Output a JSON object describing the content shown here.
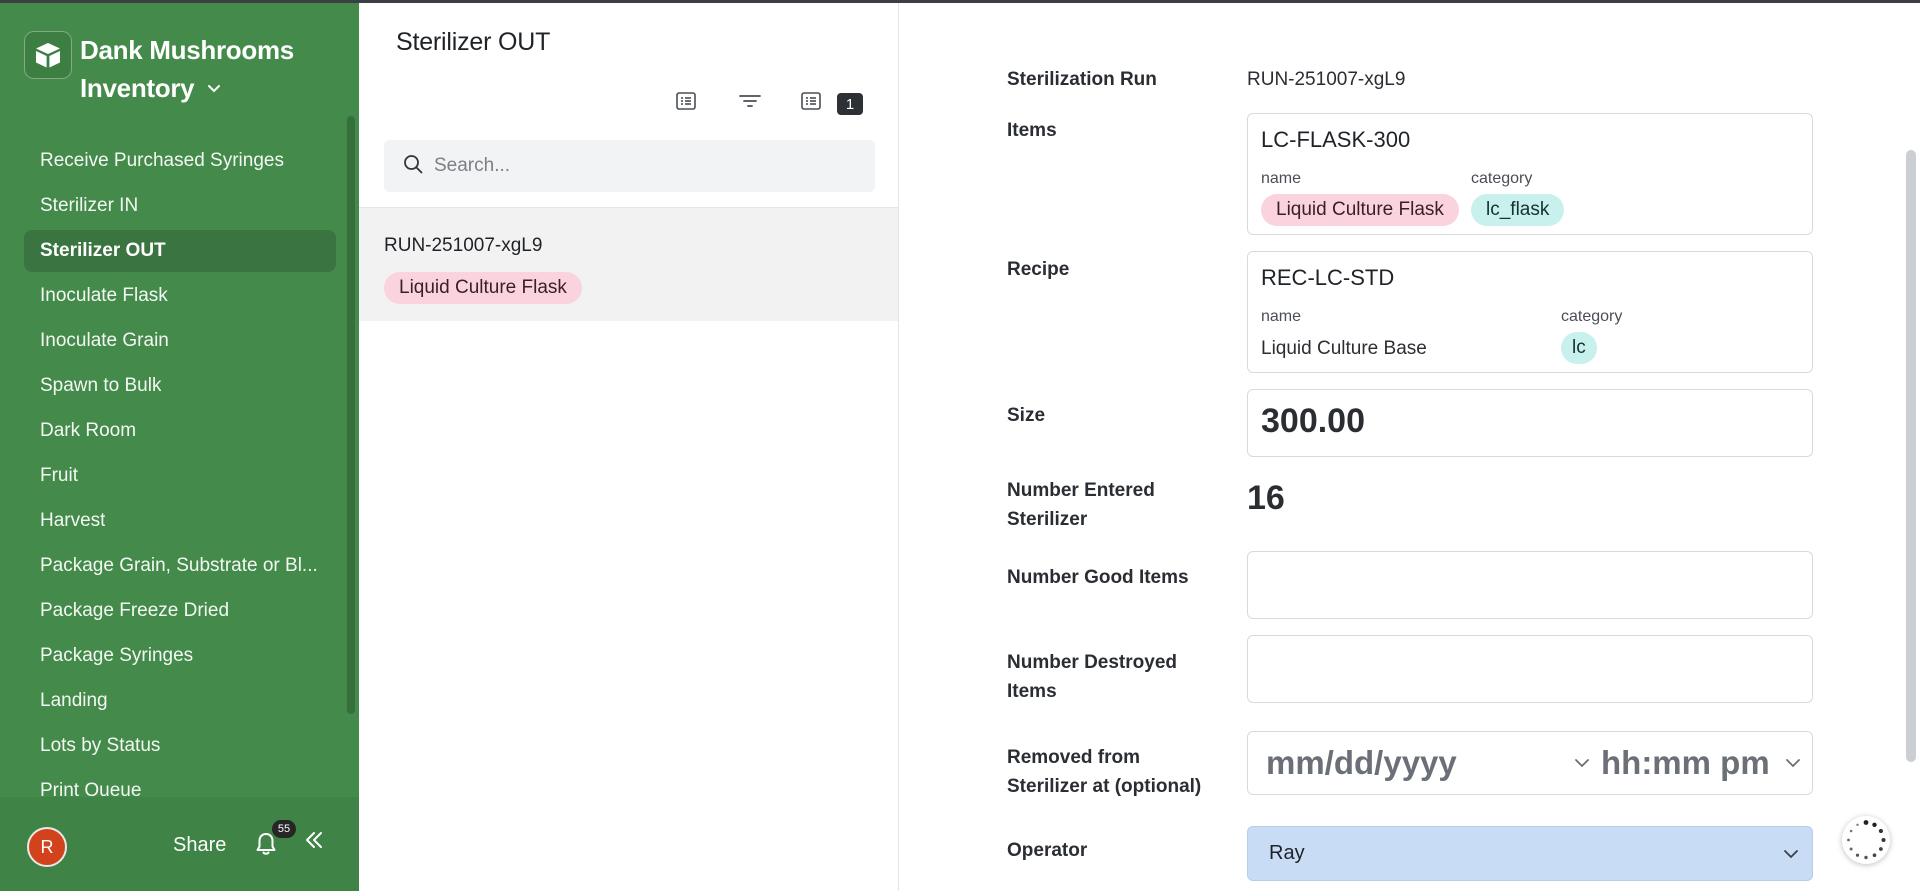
{
  "sidebar": {
    "brand_line1": "Dank Mushrooms",
    "brand_line2": "Inventory",
    "items": [
      {
        "label": "Receive Purchased Syringes"
      },
      {
        "label": "Sterilizer IN"
      },
      {
        "label": "Sterilizer OUT",
        "active": true
      },
      {
        "label": "Inoculate Flask"
      },
      {
        "label": "Inoculate Grain"
      },
      {
        "label": "Spawn to Bulk"
      },
      {
        "label": "Dark Room"
      },
      {
        "label": "Fruit"
      },
      {
        "label": "Harvest"
      },
      {
        "label": "Package Grain, Substrate or Bl..."
      },
      {
        "label": "Package Freeze Dried"
      },
      {
        "label": "Package Syringes"
      },
      {
        "label": "Landing"
      },
      {
        "label": "Lots by Status"
      },
      {
        "label": "Print Queue"
      }
    ],
    "footer": {
      "avatar_initial": "R",
      "share_label": "Share",
      "notification_count": "55"
    }
  },
  "list": {
    "title": "Sterilizer OUT",
    "filter_count": "1",
    "search_placeholder": "Search...",
    "records": [
      {
        "title": "RUN-251007-xgL9",
        "tag": "Liquid Culture Flask"
      }
    ]
  },
  "form": {
    "run": {
      "label": "Sterilization Run",
      "value": "RUN-251007-xgL9"
    },
    "items": {
      "label": "Items",
      "code": "LC-FLASK-300",
      "name_label": "name",
      "name_value": "Liquid Culture Flask",
      "category_label": "category",
      "category_value": "lc_flask"
    },
    "recipe": {
      "label": "Recipe",
      "code": "REC-LC-STD",
      "name_label": "name",
      "name_value": "Liquid Culture Base",
      "category_label": "category",
      "category_value": "lc"
    },
    "size": {
      "label": "Size",
      "value": "300.00"
    },
    "entered": {
      "label_line1": "Number Entered",
      "label_line2": "Sterilizer",
      "value": "16"
    },
    "good": {
      "label": "Number Good Items",
      "value": ""
    },
    "destroyed": {
      "label_line1": "Number Destroyed",
      "label_line2": "Items",
      "value": ""
    },
    "removed": {
      "label_line1": "Removed from",
      "label_line2": "Sterilizer at (optional)",
      "date_placeholder": "mm/dd/yyyy",
      "time_placeholder": "hh:mm pm"
    },
    "operator": {
      "label": "Operator",
      "value": "Ray"
    }
  },
  "colors": {
    "sidebar_bg": "#448a4a",
    "sidebar_active": "#3a7440",
    "pill_pink": "#fbd3de",
    "pill_teal": "#c8f1ee",
    "operator_select": "#c9dcf6",
    "avatar": "#d1421d"
  },
  "icons": {
    "brand": "box-logo-icon",
    "brand_menu": "chevron-down-icon",
    "notifications": "bell-icon",
    "collapse": "double-chevron-left-icon",
    "view_toggle": "list-view-icon",
    "filter": "filter-icon",
    "records_count": "list-icon",
    "search": "search-icon",
    "date_dropdown": "chevron-down-icon",
    "time_dropdown": "chevron-down-icon",
    "operator_dropdown": "chevron-down-icon",
    "loading": "spinner-icon"
  }
}
